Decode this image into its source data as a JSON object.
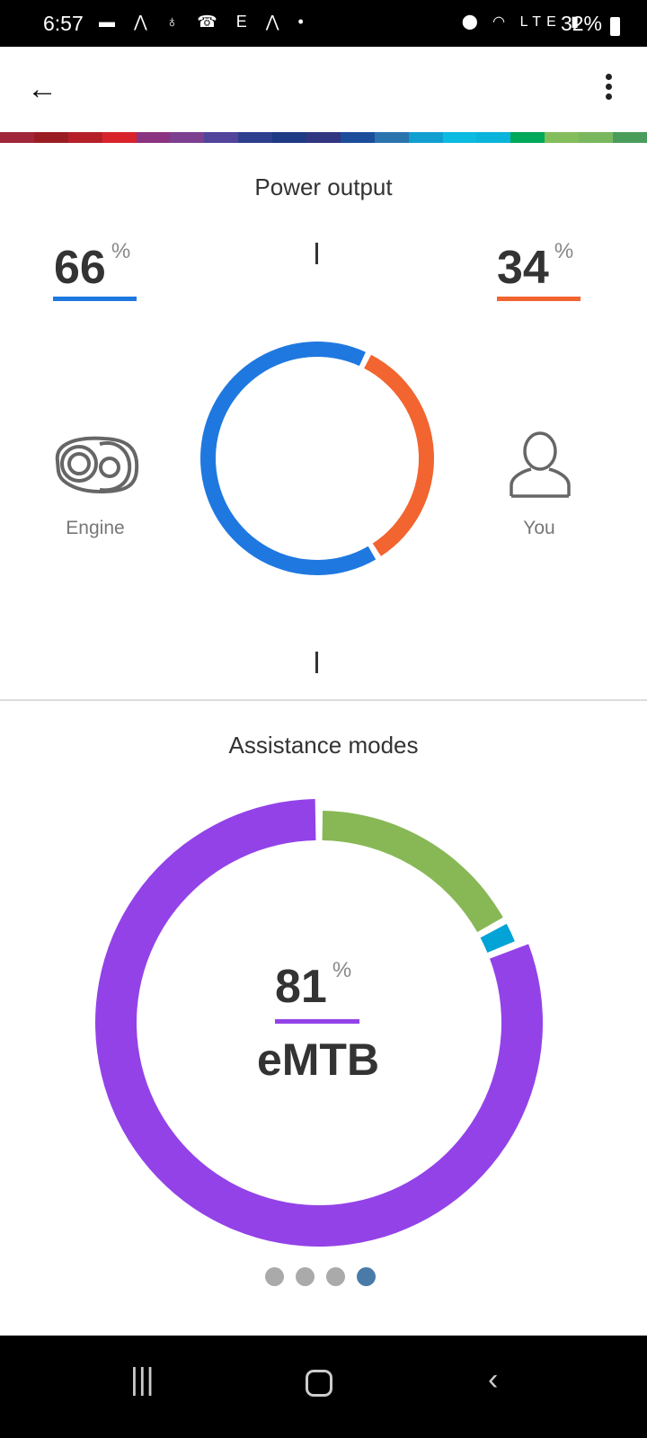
{
  "status_bar": {
    "time": "6:57",
    "battery": "32%",
    "network": "LTE",
    "notification_icons": [
      "message-icon",
      "strava-icon",
      "bike-icon",
      "missed-call-icon",
      "etsy-icon",
      "strava-icon",
      "dot-icon"
    ]
  },
  "app_bar": {
    "back_icon": "arrow-left-icon",
    "menu_icon": "more-vert-icon"
  },
  "stripe_colors": [
    "#a0263a",
    "#9b1d24",
    "#b52028",
    "#d8232a",
    "#8a3380",
    "#7d3f8f",
    "#52439b",
    "#2e3f8e",
    "#1e3a85",
    "#323580",
    "#1b4d9b",
    "#2a74ae",
    "#119fcf",
    "#0bbbe0",
    "#0bb4da",
    "#00a859",
    "#84bd5b",
    "#7ab860",
    "#4a9c5a"
  ],
  "power_output": {
    "title": "Power output",
    "engine": {
      "label": "Engine",
      "value": "66",
      "unit": "%",
      "percent": 66,
      "color": "#1f78e0"
    },
    "you": {
      "label": "You",
      "value": "34",
      "unit": "%",
      "percent": 34,
      "color": "#f26430"
    }
  },
  "assistance_modes": {
    "title": "Assistance modes",
    "selected": {
      "value": "81",
      "unit": "%",
      "name": "eMTB",
      "color": "#9342e8"
    },
    "segments": [
      {
        "percent": 17,
        "color": "#88b856"
      },
      {
        "percent": 2,
        "color": "#02a3d6"
      },
      {
        "percent": 81,
        "color": "#9342e8",
        "selected": true
      }
    ]
  },
  "pager": {
    "count": 4,
    "active": 4,
    "active_color": "#4a7ba8",
    "inactive_color": "#aaaaaa"
  },
  "nav_bar": {
    "recents_icon": "recents-icon",
    "home_icon": "home-icon",
    "back_icon": "back-icon"
  }
}
